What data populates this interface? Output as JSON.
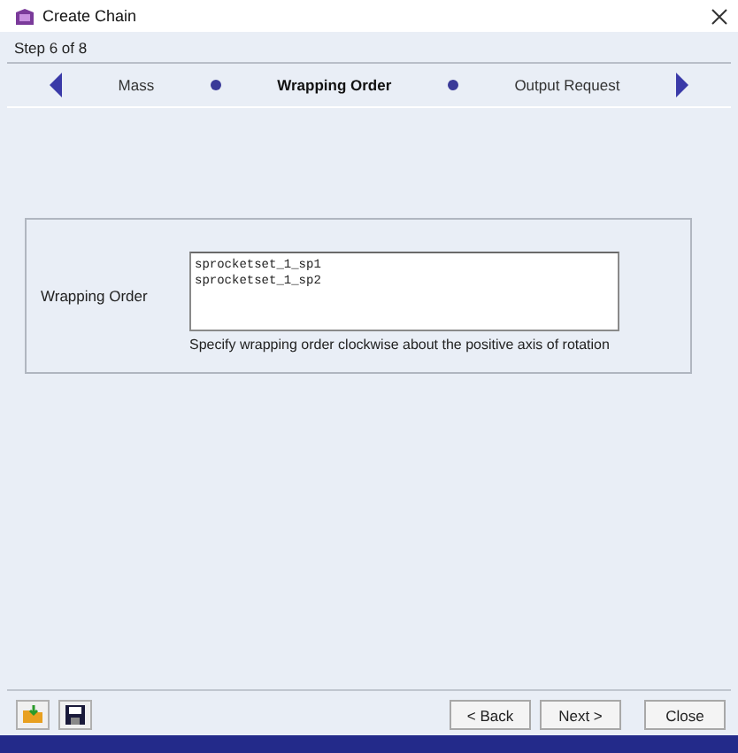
{
  "window": {
    "title": "Create Chain"
  },
  "step_indicator": "Step 6 of 8",
  "steps": [
    {
      "label": "Mass",
      "selected": false
    },
    {
      "label": "Wrapping Order",
      "selected": true
    },
    {
      "label": "Output Request",
      "selected": false
    }
  ],
  "form": {
    "label": "Wrapping Order",
    "value": [
      "sprocketset_1_sp1",
      "sprocketset_1_sp2"
    ],
    "hint": "Specify wrapping order clockwise about the positive axis of rotation"
  },
  "buttons": [
    "< Back",
    "Next >",
    "Close"
  ]
}
